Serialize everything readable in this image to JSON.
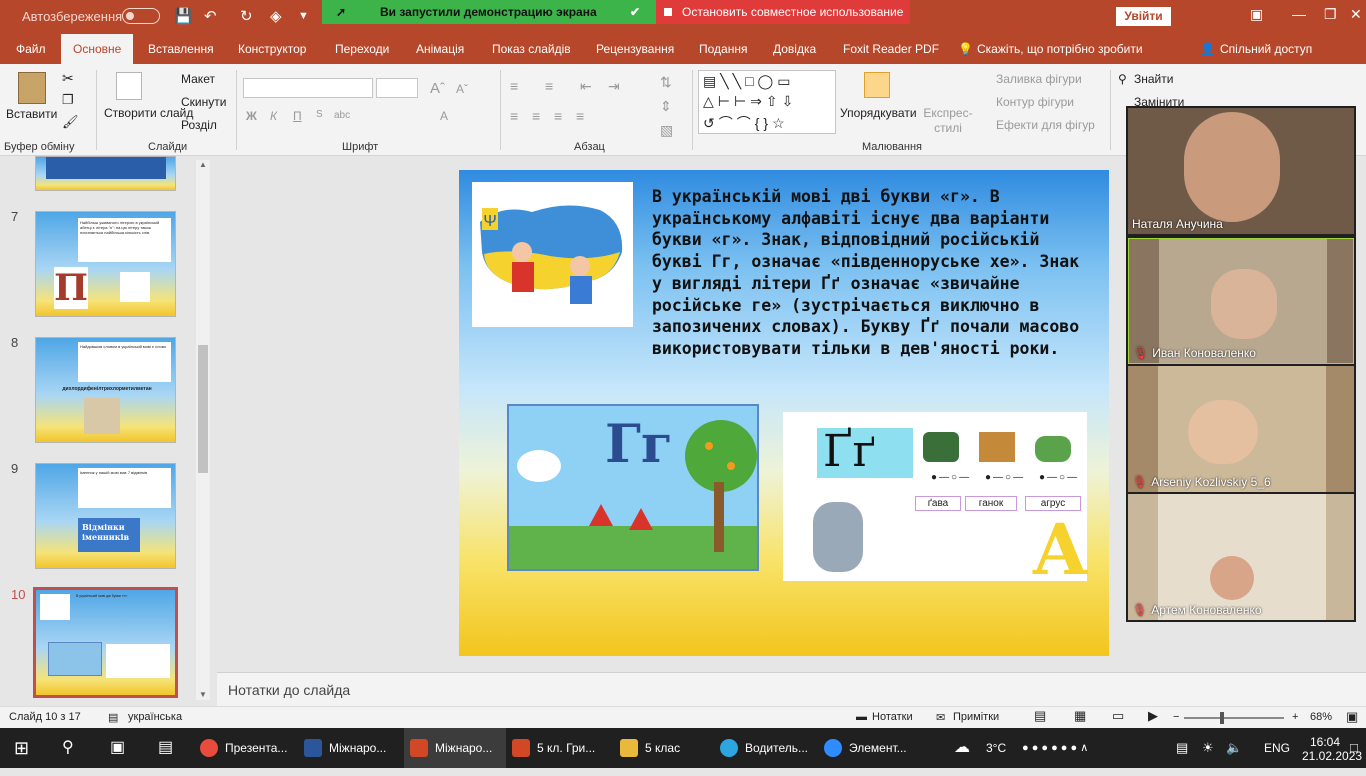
{
  "titlebar": {
    "autosave_label": "Автозбереження",
    "share_notice": "Ви запустили демонстрацию экрана",
    "stop_share": "Остановить совместное использование",
    "login_button": "Увійти"
  },
  "menu": [
    "Файл",
    "Основне",
    "Вставлення",
    "Конструктор",
    "Переходи",
    "Анімація",
    "Показ слайдів",
    "Рецензування",
    "Подання",
    "Довідка",
    "Foxit Reader PDF",
    "Скажіть, що потрібно зробити",
    "Спільний доступ"
  ],
  "ribbon": {
    "paste": "Вставити",
    "clipboard_group": "Буфер обміну",
    "new_slide": "Створити слайд",
    "layout": "Макет",
    "reset": "Скинути",
    "section": "Розділ",
    "slides_group": "Слайди",
    "font_group": "Шрифт",
    "font_buttons": [
      "Ж",
      "К",
      "П",
      "abc",
      "А"
    ],
    "paragraph_group": "Абзац",
    "arrange": "Упорядкувати",
    "quick_styles": "Експрес-стилі",
    "shape_fill": "Заливка фігури",
    "shape_outline": "Контур фігури",
    "shape_effects": "Ефекти для фігур",
    "drawing_group": "Малювання",
    "find": "Знайти",
    "replace": "Замінити"
  },
  "thumbnails": [
    {
      "num": "7",
      "text": "Найбільш уживаного літерою в українській абетці є літера \"п\": на цю літеру також починається найбільша кількість слів."
    },
    {
      "num": "8",
      "text": "Найдовшим словом в українській мові є слово",
      "word": "дихлордифенілтрихлорметилметан"
    },
    {
      "num": "9",
      "text": "Іменник у нашій мові має 7 відмінків",
      "word": "Відмінки іменників"
    },
    {
      "num": "10",
      "text": "В українській мові дві букви «г»."
    }
  ],
  "slide": {
    "text": "В українській мові дві букви «г». В українському алфавіті існує два варіанти букви «г». Знак, відповідний російській букві Гг, означає «південноруське хе». Знак у вигляді літери Ґґ означає «звичайне російське ге» (зустрічається виключно в запозичених словах). Букву Ґґ почали масово використовувати тільки в дев'яності роки.",
    "big_letter": "Гг",
    "big_letter2": "Ґґ",
    "words": [
      "ґава",
      "ганок",
      "агрус"
    ]
  },
  "notes_placeholder": "Нотатки до слайда",
  "status": {
    "slide_counter": "Слайд 10 з 17",
    "language": "українська",
    "notes": "Нотатки",
    "comments": "Примітки",
    "zoom": "68%"
  },
  "participants": [
    {
      "name": "Наталя Анучина",
      "muted": false,
      "bg": "#6f5a48"
    },
    {
      "name": "Иван Коноваленко",
      "muted": true,
      "bg": "#8a7660"
    },
    {
      "name": "Arseniy Kozlivskiy 5_6",
      "muted": true,
      "bg": "#a58a6a"
    },
    {
      "name": "Артем Коноваленко",
      "muted": true,
      "bg": "#c9b79c"
    }
  ],
  "taskbar": {
    "items": [
      {
        "label": "Презента...",
        "color": "#e74c3c"
      },
      {
        "label": "Міжнаро...",
        "color": "#2b579a"
      },
      {
        "label": "Міжнаро...",
        "color": "#d24726"
      },
      {
        "label": "5 кл. Гри...",
        "color": "#d24726"
      },
      {
        "label": "5 клас",
        "color": "#e8b93b"
      },
      {
        "label": "Водитель...",
        "color": "#2ca5e0"
      },
      {
        "label": "Элемент...",
        "color": "#2d8cff"
      }
    ],
    "temperature": "3°C",
    "lang": "ENG",
    "time": "16:04",
    "date": "21.02.2023"
  },
  "colors": {
    "accent": "#b7472a",
    "selected_thumb": "#c0504d"
  }
}
